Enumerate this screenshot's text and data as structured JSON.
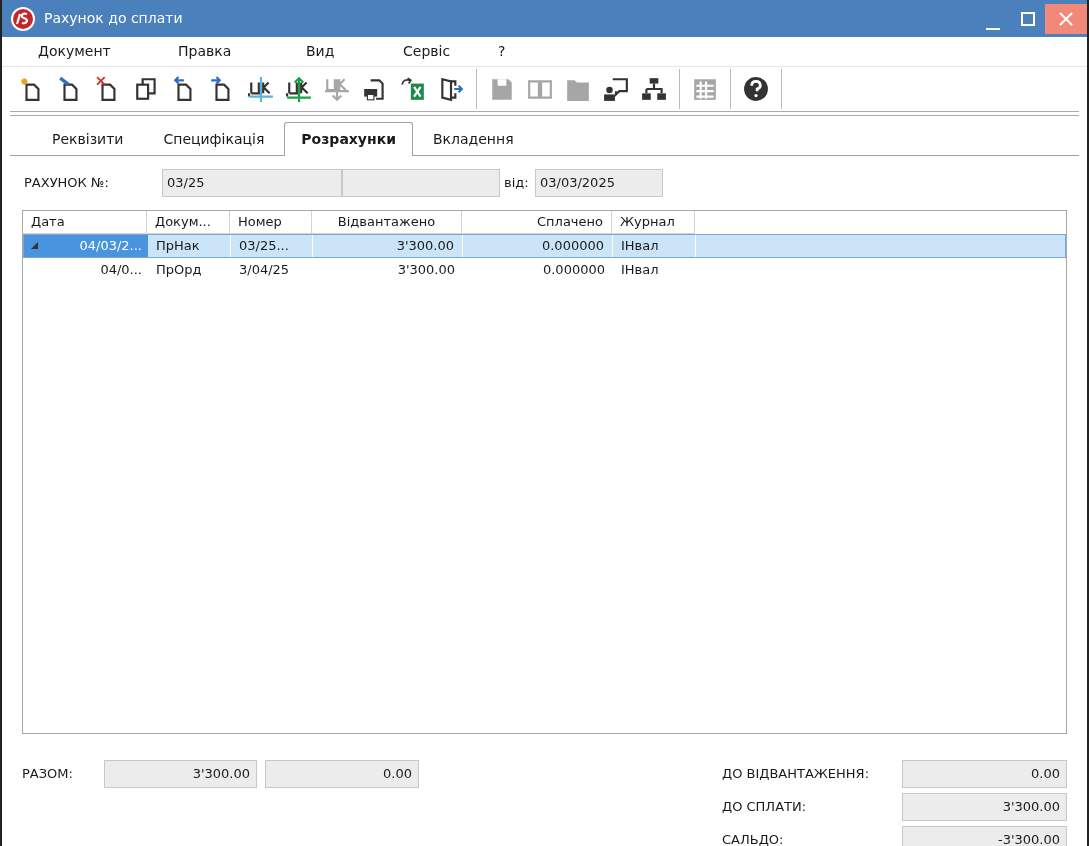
{
  "window": {
    "title": "Рахунок до сплати"
  },
  "menu": [
    {
      "label": "Документ"
    },
    {
      "label": "Правка"
    },
    {
      "label": "Вид"
    },
    {
      "label": "Сервіс"
    },
    {
      "label": "?"
    }
  ],
  "toolbar": [
    {
      "kind": "new",
      "disabled": false
    },
    {
      "kind": "edit",
      "disabled": false
    },
    {
      "kind": "delete",
      "disabled": false
    },
    {
      "kind": "copy",
      "disabled": false
    },
    {
      "kind": "back",
      "disabled": false
    },
    {
      "kind": "forward",
      "disabled": false
    },
    {
      "kind": "dk-blue",
      "disabled": false
    },
    {
      "kind": "dk-green",
      "disabled": false
    },
    {
      "kind": "dk-down",
      "disabled": true
    },
    {
      "kind": "print",
      "disabled": false
    },
    {
      "kind": "excel",
      "disabled": false
    },
    {
      "kind": "exit",
      "disabled": false
    },
    {
      "kind": "separator"
    },
    {
      "kind": "save",
      "disabled": true
    },
    {
      "kind": "book",
      "disabled": true
    },
    {
      "kind": "folder",
      "disabled": true
    },
    {
      "kind": "user-comment",
      "disabled": false
    },
    {
      "kind": "hierarchy",
      "disabled": false
    },
    {
      "kind": "separator"
    },
    {
      "kind": "grid",
      "disabled": true
    },
    {
      "kind": "separator"
    },
    {
      "kind": "help",
      "disabled": false
    },
    {
      "kind": "separator"
    }
  ],
  "tabs": [
    {
      "label": "Реквізити",
      "selected": false
    },
    {
      "label": "Специфікація",
      "selected": false
    },
    {
      "label": "Розрахунки",
      "selected": true
    },
    {
      "label": "Вкладення",
      "selected": false
    }
  ],
  "header": {
    "label": "РАХУНОК №:",
    "number": "03/25",
    "date_label": "від:",
    "date": "03/03/2025"
  },
  "table": {
    "columns": [
      "Дата",
      "Докум...",
      "Номер",
      "Відвантажено",
      "Сплачено",
      "Журнал"
    ],
    "rows": [
      {
        "cells": [
          "04/03/2...",
          "ПрНак",
          "03/25...",
          "3'300.00",
          "0.000000",
          "ІНвал"
        ],
        "selected": true,
        "expanded": true,
        "children": [
          {
            "cells": [
              "04/0...",
              "ПрОрд",
              "3/04/25",
              "3'300.00",
              "0.000000",
              "ІНвал"
            ],
            "selected": false
          }
        ]
      }
    ]
  },
  "totals": {
    "label": "РАЗОМ:",
    "shipped": "3'300.00",
    "paid": "0.00"
  },
  "summary": [
    {
      "label": "ДО ВІДВАНТАЖЕННЯ:",
      "value": "0.00"
    },
    {
      "label": "ДО СПЛАТИ:",
      "value": "3'300.00"
    },
    {
      "label": "САЛЬДО:",
      "value": "-3'300.00"
    }
  ]
}
